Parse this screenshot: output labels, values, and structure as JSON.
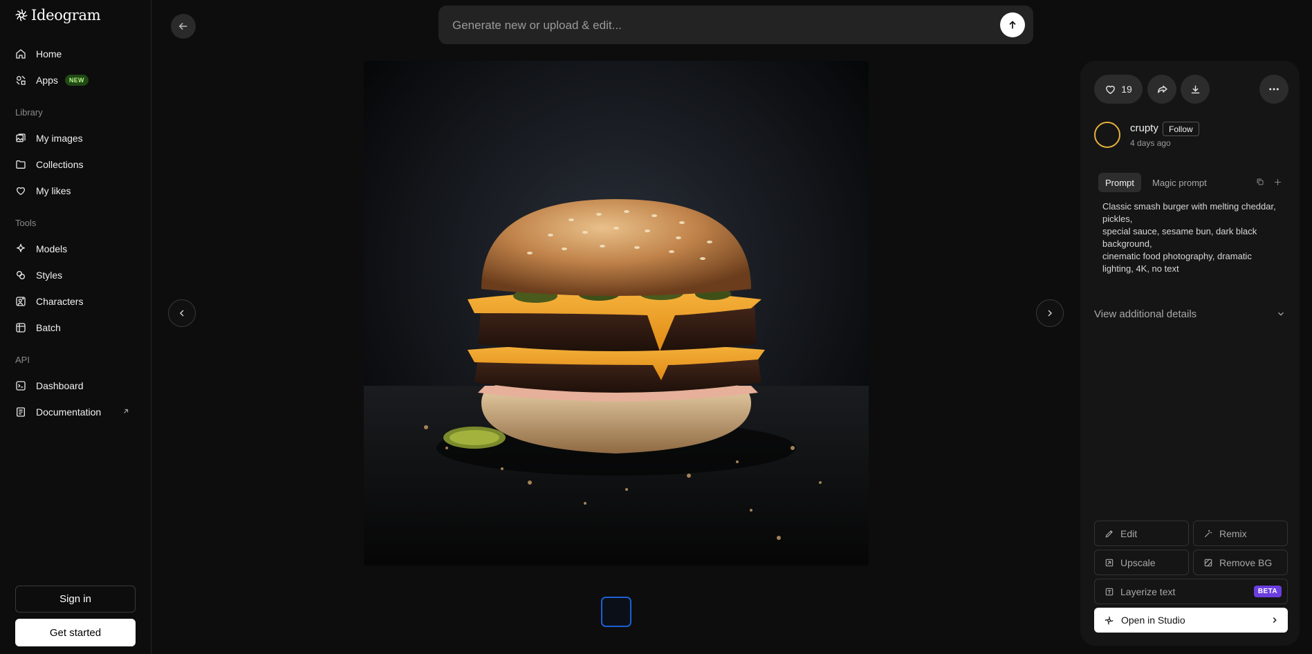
{
  "app": {
    "logo_text": "Ideogram"
  },
  "sidebar": {
    "items_main": [
      {
        "label": "Home",
        "icon": "home-icon"
      },
      {
        "label": "Apps",
        "icon": "apps-icon",
        "badge": "NEW"
      }
    ],
    "library_label": "Library",
    "items_library": [
      {
        "label": "My images",
        "icon": "images-icon"
      },
      {
        "label": "Collections",
        "icon": "folder-icon"
      },
      {
        "label": "My likes",
        "icon": "heart-icon"
      }
    ],
    "tools_label": "Tools",
    "items_tools": [
      {
        "label": "Models",
        "icon": "sparkle-icon"
      },
      {
        "label": "Styles",
        "icon": "styles-icon"
      },
      {
        "label": "Characters",
        "icon": "character-icon"
      },
      {
        "label": "Batch",
        "icon": "batch-icon"
      }
    ],
    "api_label": "API",
    "items_api": [
      {
        "label": "Dashboard",
        "icon": "terminal-icon"
      },
      {
        "label": "Documentation",
        "icon": "document-icon",
        "external": true
      }
    ],
    "signin_label": "Sign in",
    "getstarted_label": "Get started"
  },
  "prompt_bar": {
    "placeholder": "Generate new or upload & edit..."
  },
  "detail": {
    "like_count": "19",
    "username": "crupty",
    "follow_label": "Follow",
    "time_ago": "4 days ago",
    "tab_prompt": "Prompt",
    "tab_magic_prompt": "Magic prompt",
    "prompt_text": "Classic smash burger with melting cheddar,\npickles,\nspecial sauce, sesame bun, dark black\nbackground,\ncinematic food photography, dramatic\nlighting, 4K, no text",
    "view_details_label": "View additional details",
    "actions": {
      "edit": "Edit",
      "remix": "Remix",
      "upscale": "Upscale",
      "remove_bg": "Remove BG",
      "layerize_text": "Layerize text",
      "beta_badge": "BETA",
      "open_studio": "Open in Studio"
    }
  },
  "colors": {
    "background": "#0d0d0d",
    "panel": "#151515",
    "accent_new": "#b8f08a",
    "accent_beta": "#6b3ee0",
    "thumb_border": "#1e5fd6",
    "avatar_ring": "#e8b23a"
  }
}
